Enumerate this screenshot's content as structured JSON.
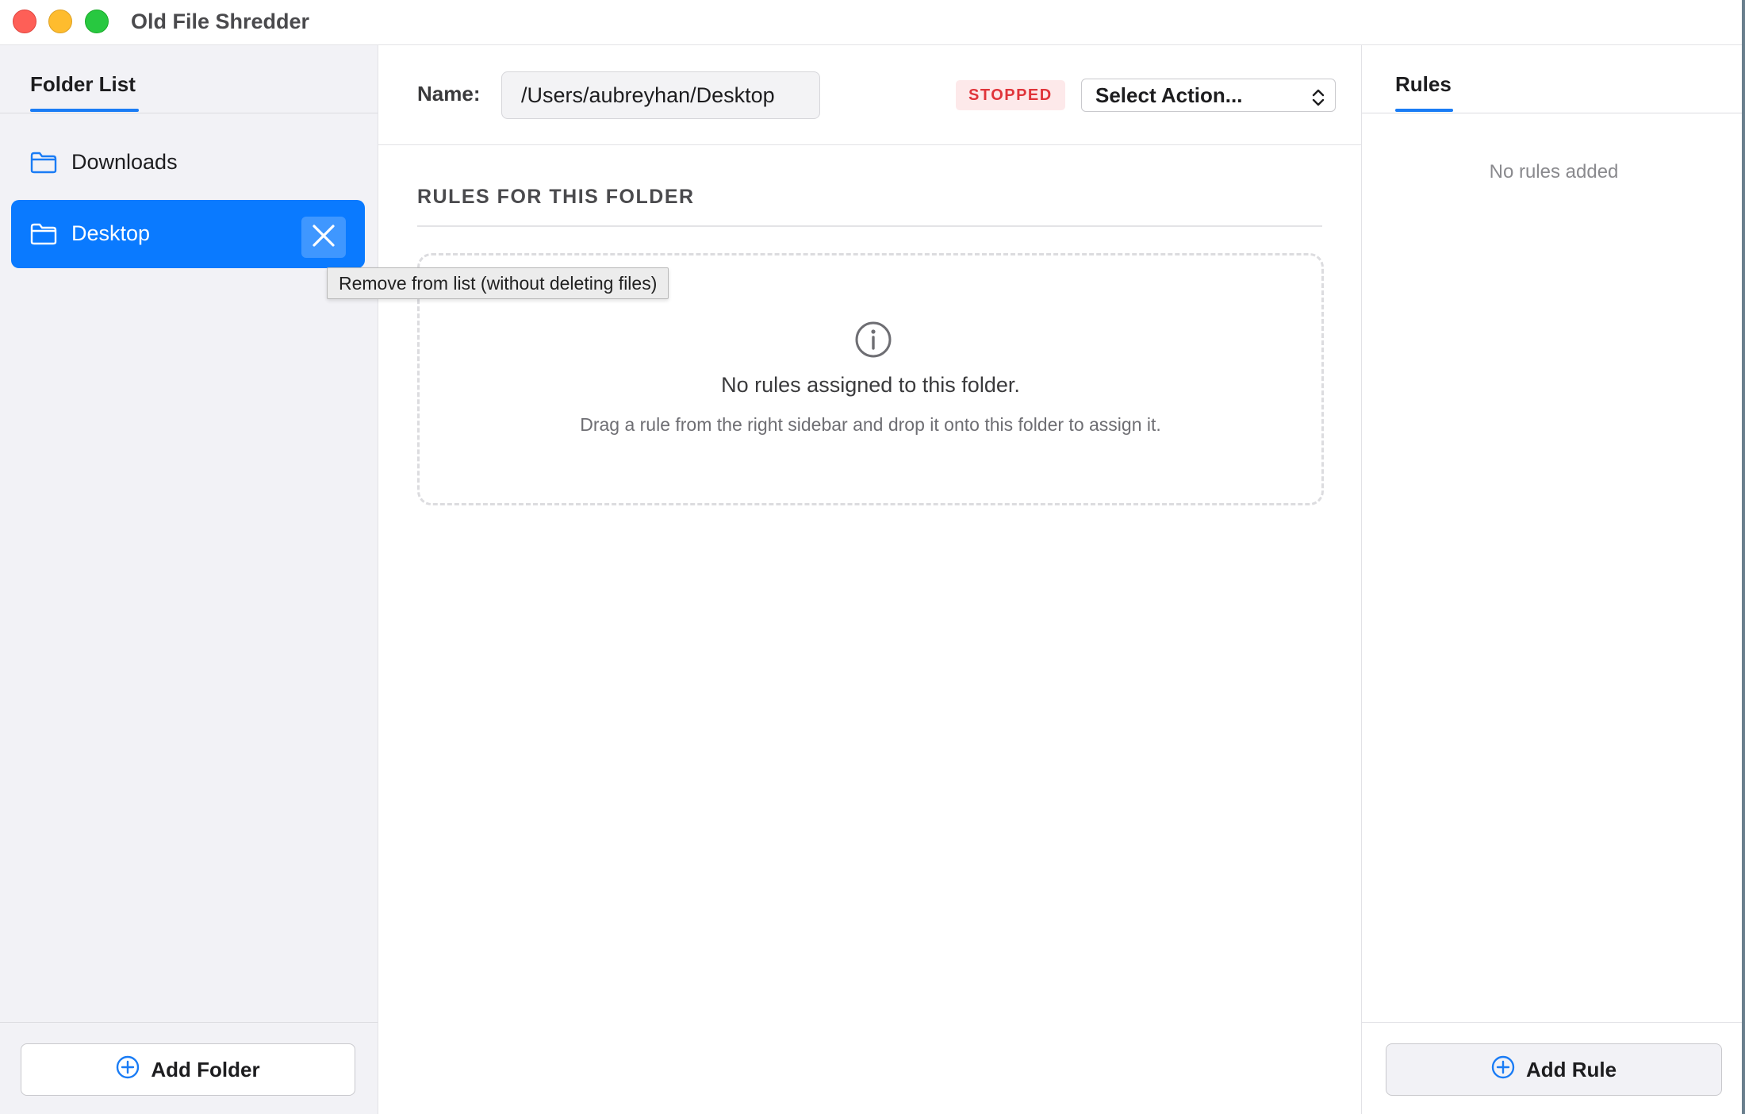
{
  "window": {
    "title": "Old File Shredder"
  },
  "left_sidebar": {
    "tab_label": "Folder List",
    "folders": [
      {
        "label": "Downloads",
        "icon": "folder-icon",
        "selected": false
      },
      {
        "label": "Desktop",
        "icon": "folder-icon",
        "selected": true
      }
    ],
    "remove_tooltip": "Remove from list (without deleting files)",
    "add_button_label": "Add Folder",
    "add_button_icon": "plus-circle-icon"
  },
  "main": {
    "name_label": "Name:",
    "name_value": "/Users/aubreyhan/Desktop",
    "status": "STOPPED",
    "action_select": "Select Action...",
    "section_title": "RULES FOR THIS FOLDER",
    "empty_title": "No rules assigned to this folder.",
    "empty_subtitle": "Drag a rule from the right sidebar and drop it onto this folder to assign it.",
    "empty_icon": "info-icon"
  },
  "right_sidebar": {
    "tab_label": "Rules",
    "empty_text": "No rules added",
    "add_button_label": "Add Rule",
    "add_button_icon": "plus-circle-icon"
  },
  "colors": {
    "accent": "#0a7aff",
    "status_stopped": "#e0343a",
    "sidebar_bg": "#f2f2f6"
  }
}
